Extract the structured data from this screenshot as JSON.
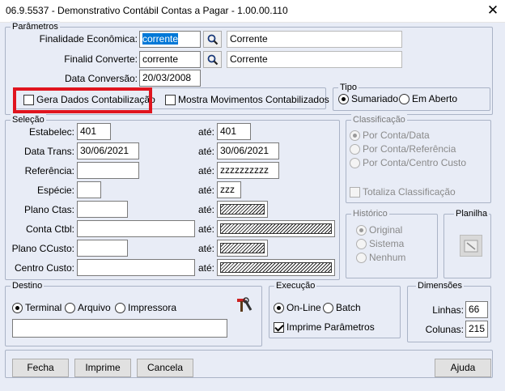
{
  "window": {
    "title": "06.9.5537 - Demonstrativo Contábil Contas a Pagar - 1.00.00.110",
    "close_glyph": "✕"
  },
  "parametros": {
    "legend": "Parâmetros",
    "finalidade_label": "Finalidade Econômica:",
    "finalidade_value": "corrente",
    "finalidade_desc": "Corrente",
    "finalid_conv_label": "Finalid Converte:",
    "finalid_conv_value": "corrente",
    "finalid_conv_desc": "Corrente",
    "data_conv_label": "Data Conversão:",
    "data_conv_value": "20/03/2008",
    "gera_dados_label": "Gera Dados Contabilização",
    "mostra_mov_label": "Mostra Movimentos Contabilizados",
    "highlight_color": "#e0141e"
  },
  "tipo": {
    "legend": "Tipo",
    "sumariado": "Sumariado",
    "em_aberto": "Em Aberto"
  },
  "selecao": {
    "legend": "Seleção",
    "ate": "até:",
    "estabelec_label": "Estabelec:",
    "estabelec_from": "401",
    "estabelec_to": "401",
    "data_trans_label": "Data Trans:",
    "data_trans_from": "30/06/2021",
    "data_trans_to": "30/06/2021",
    "referencia_label": "Referência:",
    "referencia_from": "",
    "referencia_to": "zzzzzzzzzz",
    "especie_label": "Espécie:",
    "especie_from": "",
    "especie_to": "zzz",
    "plano_ctas_label": "Plano Ctas:",
    "conta_ctbl_label": "Conta Ctbl:",
    "plano_ccusto_label": "Plano CCusto:",
    "centro_custo_label": "Centro Custo:"
  },
  "classificacao": {
    "legend": "Classificação",
    "por_conta_data": "Por Conta/Data",
    "por_conta_referencia": "Por Conta/Referência",
    "por_conta_centro_custo": "Por Conta/Centro Custo",
    "totaliza": "Totaliza Classificação"
  },
  "historico": {
    "legend": "Histórico",
    "original": "Original",
    "sistema": "Sistema",
    "nenhum": "Nenhum"
  },
  "planilha": {
    "legend": "Planilha"
  },
  "destino": {
    "legend": "Destino",
    "terminal": "Terminal",
    "arquivo": "Arquivo",
    "impressora": "Impressora",
    "path_value": ""
  },
  "execucao": {
    "legend": "Execução",
    "on_line": "On-Line",
    "batch": "Batch",
    "imprime_param": "Imprime Parâmetros"
  },
  "dimensoes": {
    "legend": "Dimensões",
    "linhas_label": "Linhas:",
    "linhas_value": "66",
    "colunas_label": "Colunas:",
    "colunas_value": "215"
  },
  "buttons": {
    "fecha": "Fecha",
    "imprime": "Imprime",
    "cancela": "Cancela",
    "ajuda": "Ajuda"
  }
}
